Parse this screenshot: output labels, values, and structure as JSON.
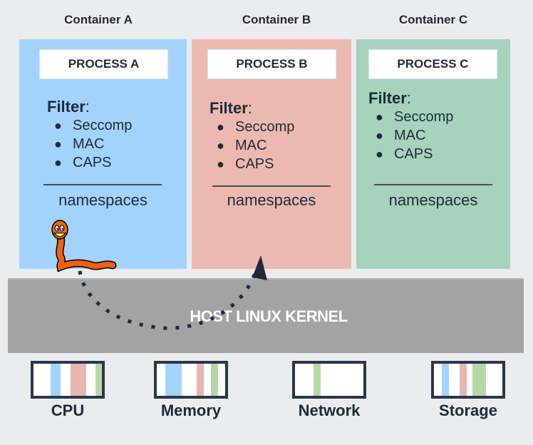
{
  "colors": {
    "background": "#ebecee",
    "container_a": "#a2d3fd",
    "container_b": "#ecb9b0",
    "container_c": "#a7d3bc",
    "kernel": "#a3a3a3",
    "text": "#1f2a3c",
    "worm": "#f06010",
    "band_blue": "#a2d3fd",
    "band_red": "#e8b6b0",
    "band_green": "#b6d8a8"
  },
  "containers": [
    {
      "title": "Container A",
      "process": "PROCESS A",
      "filter_heading": "Filter",
      "filter_colon": ":",
      "filters": [
        "Seccomp",
        "MAC",
        "CAPS"
      ],
      "bullet": "●",
      "namespaces": "namespaces"
    },
    {
      "title": "Container B",
      "process": "PROCESS B",
      "filter_heading": "Filter",
      "filter_colon": ":",
      "filters": [
        "Seccomp",
        "MAC",
        "CAPS"
      ],
      "bullet": "●",
      "namespaces": "namespaces"
    },
    {
      "title": "Container C",
      "process": "PROCESS C",
      "filter_heading": "Filter",
      "filter_colon": ":",
      "filters": [
        "Seccomp",
        "MAC",
        "CAPS"
      ],
      "bullet": "●",
      "namespaces": "namespaces"
    }
  ],
  "worm": {
    "icon": "worm-icon",
    "description": "cartoon orange worm escaping Container A"
  },
  "escape_arrow": {
    "from": "Container A",
    "to": "Container B",
    "via": "HOST LINUX KERNEL",
    "style": "dotted"
  },
  "kernel": {
    "label": "HOST LINUX KERNEL"
  },
  "resources": [
    {
      "label": "CPU",
      "bands": [
        "blue",
        "red",
        "green"
      ]
    },
    {
      "label": "Memory",
      "bands": [
        "blue",
        "red",
        "green"
      ]
    },
    {
      "label": "Network",
      "bands": [
        "green"
      ]
    },
    {
      "label": "Storage",
      "bands": [
        "blue",
        "red",
        "green"
      ]
    }
  ]
}
